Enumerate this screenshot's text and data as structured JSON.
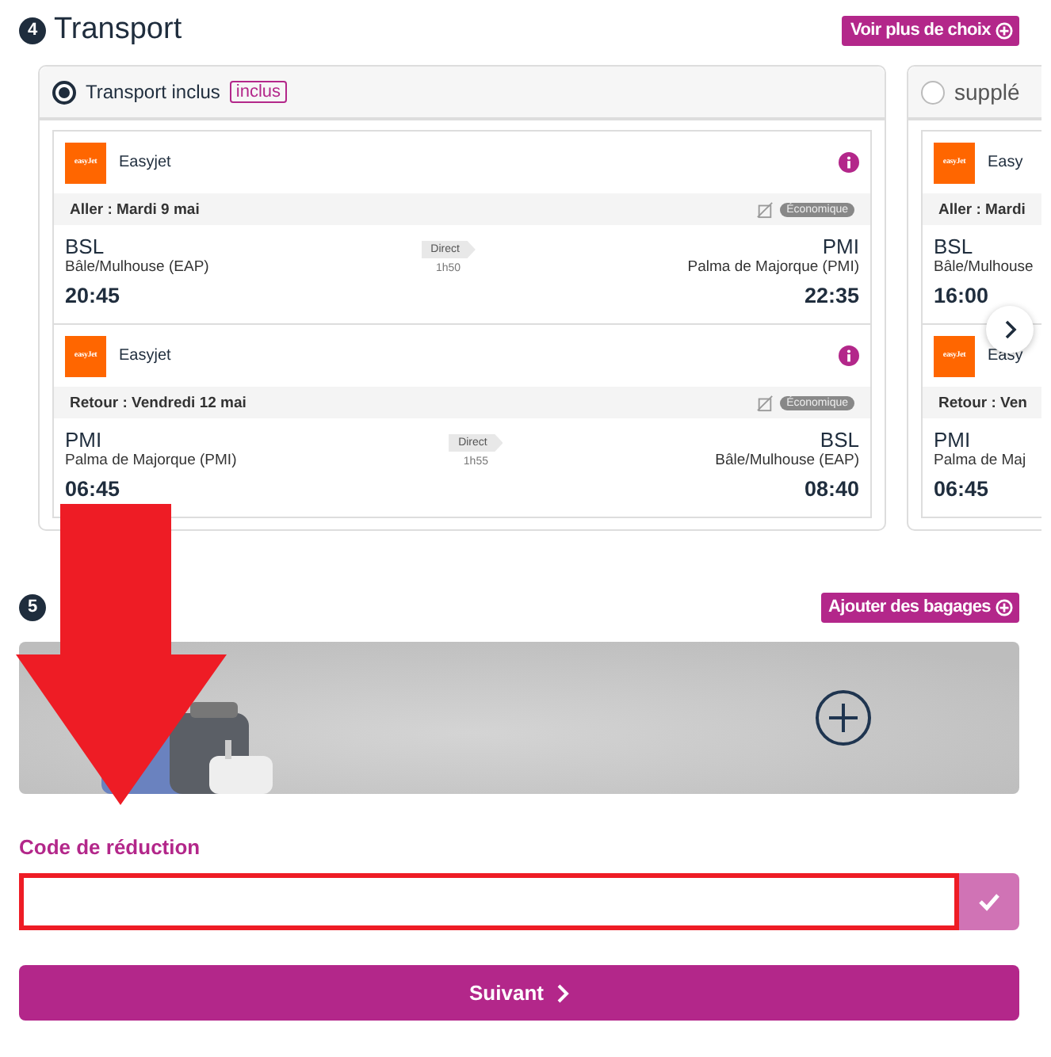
{
  "transport": {
    "number": "4",
    "title": "Transport",
    "more_button": "Voir plus de choix",
    "options": [
      {
        "selected": true,
        "label": "Transport inclus",
        "tag": "inclus",
        "flights": [
          {
            "logo": "easyJet",
            "airline": "Easyjet",
            "direction": "Aller : Mardi 9 mai",
            "cabin": "Économique",
            "from_code": "BSL",
            "from_name": "Bâle/Mulhouse (EAP)",
            "from_time": "20:45",
            "stop": "Direct",
            "duration": "1h50",
            "to_code": "PMI",
            "to_name": "Palma de Majorque (PMI)",
            "to_time": "22:35"
          },
          {
            "logo": "easyJet",
            "airline": "Easyjet",
            "direction": "Retour : Vendredi 12 mai",
            "cabin": "Économique",
            "from_code": "PMI",
            "from_name": "Palma de Majorque (PMI)",
            "from_time": "06:45",
            "stop": "Direct",
            "duration": "1h55",
            "to_code": "BSL",
            "to_name": "Bâle/Mulhouse (EAP)",
            "to_time": "08:40"
          }
        ]
      },
      {
        "selected": false,
        "label": "supplé",
        "flights": [
          {
            "logo": "easyJet",
            "airline": "Easy",
            "direction": "Aller : Mardi",
            "from_code": "BSL",
            "from_name": "Bâle/Mulhouse",
            "from_time": "16:00"
          },
          {
            "logo": "easyJet",
            "airline": "Easy",
            "direction": "Retour : Ven",
            "from_code": "PMI",
            "from_name": "Palma de Maj",
            "from_time": "06:45"
          }
        ]
      }
    ]
  },
  "baggage": {
    "number": "5",
    "add_button": "Ajouter des bagages"
  },
  "discount": {
    "label": "Code de réduction"
  },
  "next_button": "Suivant"
}
